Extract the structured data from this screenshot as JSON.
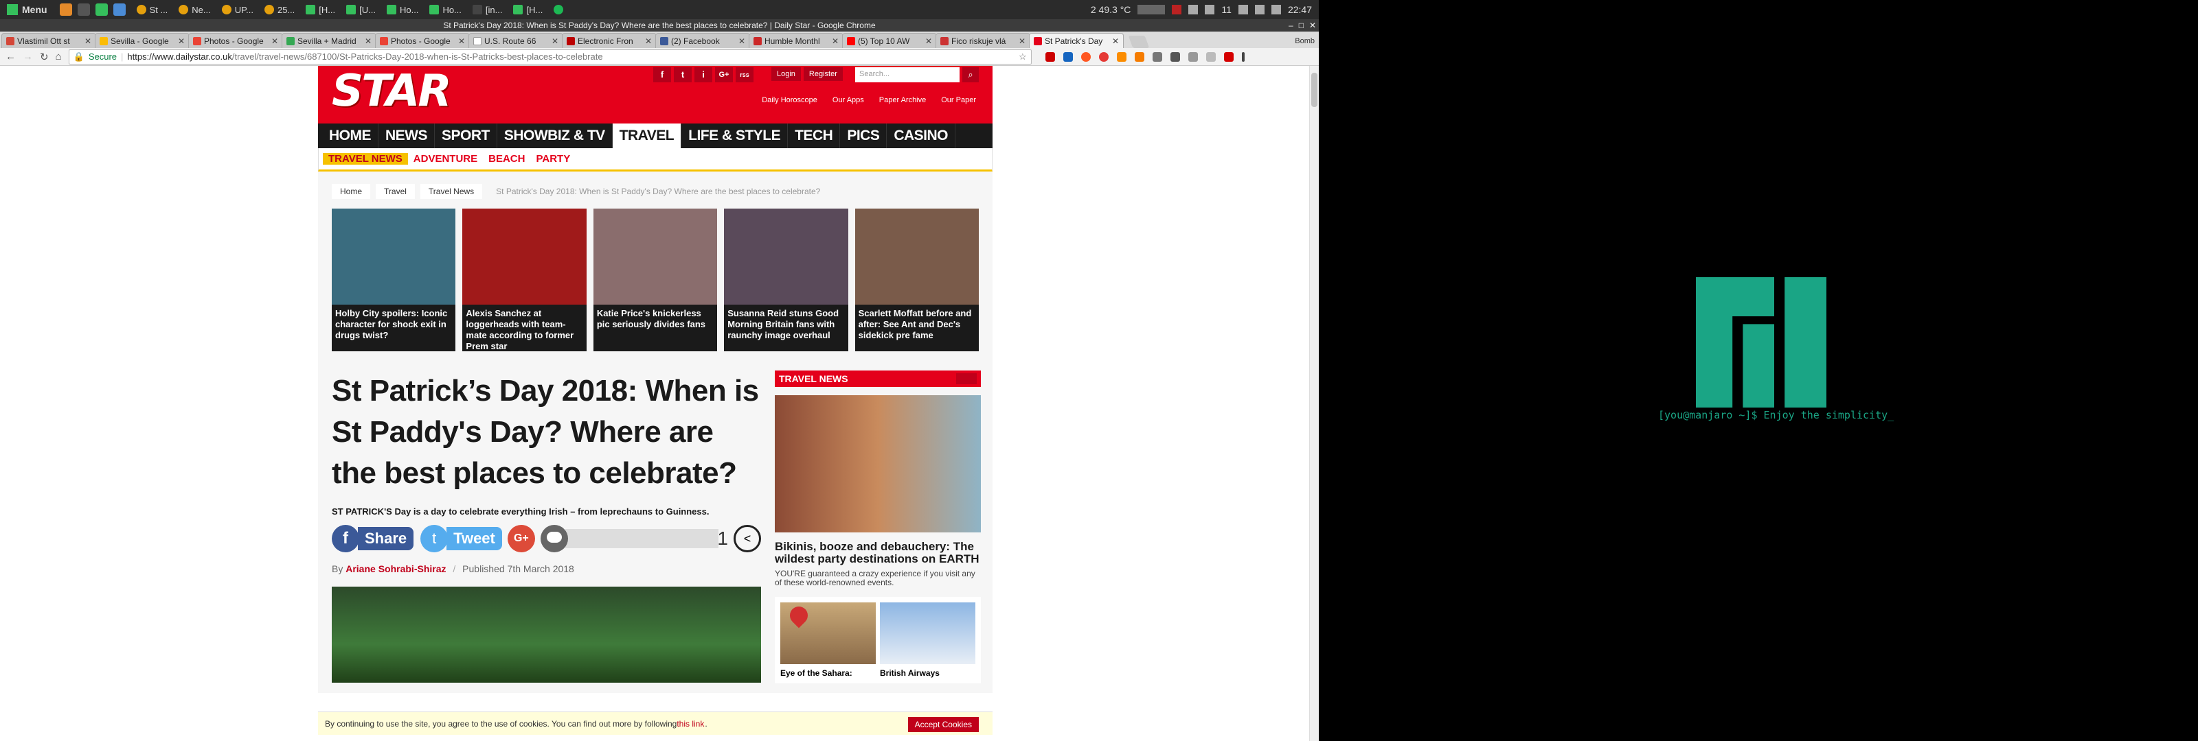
{
  "taskbar": {
    "menu_label": "Menu",
    "tasks": [
      {
        "label": "St ..."
      },
      {
        "label": "Ne..."
      },
      {
        "label": "UP..."
      },
      {
        "label": "25..."
      },
      {
        "label": "[H..."
      },
      {
        "label": "[U..."
      },
      {
        "label": "Ho..."
      },
      {
        "label": "Ho..."
      },
      {
        "label": "[in..."
      },
      {
        "label": "[H..."
      }
    ],
    "weather": "2  49.3 °C",
    "workspace_num": "11",
    "clock": "22:47"
  },
  "browser": {
    "window_title": "St Patrick's Day 2018: When is St Paddy's Day? Where are the best places to celebrate? | Daily Star - Google Chrome",
    "tabs": [
      {
        "label": "Vlastimil Ott st"
      },
      {
        "label": "Sevilla - Google"
      },
      {
        "label": "Photos - Google"
      },
      {
        "label": "Sevilla + Madrid"
      },
      {
        "label": "Photos - Google"
      },
      {
        "label": "U.S. Route 66"
      },
      {
        "label": "Electronic Fron"
      },
      {
        "label": "(2) Facebook"
      },
      {
        "label": "Humble Monthl"
      },
      {
        "label": "(5) Top 10 AW"
      },
      {
        "label": "Fico riskuje vlá"
      },
      {
        "label": "St Patrick's Day"
      }
    ],
    "profile": "Bomb",
    "secure_label": "Secure",
    "url_host": "https://www.dailystar.co.uk",
    "url_path": "/travel/travel-news/687100/St-Patricks-Day-2018-when-is-St-Patricks-best-places-to-celebrate"
  },
  "site": {
    "logo": "STAR",
    "social_icons": [
      "f",
      "t",
      "i",
      "G+",
      "rss"
    ],
    "login": "Login",
    "register": "Register",
    "search_placeholder": "Search...",
    "subnav": [
      "Daily Horoscope",
      "Our Apps",
      "Paper Archive",
      "Our Paper"
    ],
    "mainnav": [
      {
        "label": "HOME"
      },
      {
        "label": "NEWS"
      },
      {
        "label": "SPORT"
      },
      {
        "label": "SHOWBIZ & TV"
      },
      {
        "label": "TRAVEL"
      },
      {
        "label": "LIFE & STYLE"
      },
      {
        "label": "TECH"
      },
      {
        "label": "PICS"
      },
      {
        "label": "CASINO"
      }
    ],
    "secnav": [
      {
        "label": "TRAVEL NEWS"
      },
      {
        "label": "ADVENTURE"
      },
      {
        "label": "BEACH"
      },
      {
        "label": "PARTY"
      }
    ],
    "breadcrumb": [
      "Home",
      "Travel",
      "Travel News",
      "St Patrick's Day 2018: When is St Paddy's Day? Where are the best places to celebrate?"
    ],
    "cards": [
      {
        "caption": "Holby City spoilers: Iconic character for shock exit in drugs twist?",
        "color": "#3a6c7f"
      },
      {
        "caption": "Alexis Sanchez at loggerheads with team-mate according to former Prem star",
        "color": "#a01a1a"
      },
      {
        "caption": "Katie Price's knickerless pic seriously divides fans",
        "color": "#8a6d6d"
      },
      {
        "caption": "Susanna Reid stuns Good Morning Britain fans with raunchy image overhaul",
        "color": "#5a4a5a"
      },
      {
        "caption": "Scarlett Moffatt before and after: See Ant and Dec's sidekick pre fame",
        "color": "#7a5b4a"
      }
    ],
    "headline": "St Patrick’s Day 2018: When is St Paddy's Day? Where are the best places to celebrate?",
    "standfirst": "ST PATRICK'S Day is a day to celebrate everything Irish – from leprechauns to Guinness.",
    "share_label": "Share",
    "tweet_label": "Tweet",
    "gplus_label": "G+",
    "share_count": "1",
    "byline_prefix": "By",
    "author": "Ariane Sohrabi-Shiraz",
    "byline_sep": "/",
    "published": "Published 7th March 2018",
    "sidebar": {
      "heading": "TRAVEL NEWS",
      "feature_title": "Bikinis, booze and debauchery: The wildest party destinations on EARTH",
      "feature_desc": "YOU'RE guaranteed a crazy experience if you visit any of these world-renowned events.",
      "cards": [
        {
          "title": "Eye of the Sahara:"
        },
        {
          "title": "British Airways"
        }
      ]
    },
    "cookie": {
      "text": "By continuing to use the site, you agree to the use of cookies. You can find out more by following ",
      "link": "this link",
      "button": "Accept Cookies"
    }
  },
  "desktop": {
    "prompt": "[you@manjaro ~]$ Enjoy the simplicity_",
    "accent": "#1aa585"
  }
}
